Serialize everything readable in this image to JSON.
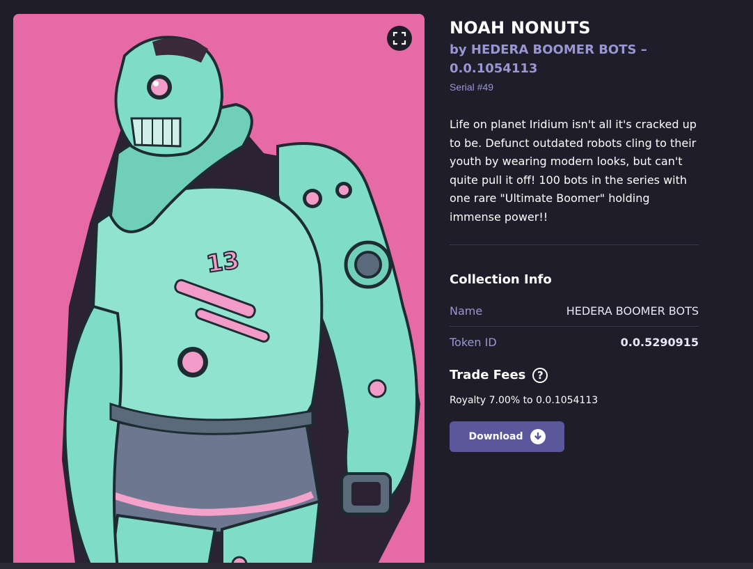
{
  "nft": {
    "title": "NOAH NONUTS",
    "by_line": "by HEDERA BOOMER BOTS – 0.0.1054113",
    "serial": "Serial #49",
    "description": "Life on planet Iridium isn't all it's cracked up to be. Defunct outdated robots cling to their youth by wearing modern looks, but can't quite pull it off! 100 bots in the series with one rare \"Ultimate Boomer\" holding immense power!!",
    "artwork_icon": "robot-artwork-image",
    "artwork_number": "13"
  },
  "collection_info": {
    "heading": "Collection Info",
    "rows": [
      {
        "label": "Name",
        "value": "HEDERA BOOMER BOTS"
      },
      {
        "label": "Token ID",
        "value": "0.0.5290915"
      }
    ]
  },
  "trade_fees": {
    "heading": "Trade Fees",
    "help_glyph": "?",
    "royalty": "Royalty 7.00% to 0.0.1054113"
  },
  "actions": {
    "download_label": "Download"
  },
  "colors": {
    "background": "#1e1d29",
    "artwork_bg": "#e56aa6",
    "robot": "#7fdcc6",
    "accent_text": "#9a96d2",
    "button": "#5a579c"
  },
  "icons": {
    "expand": "expand-icon",
    "help": "help-icon",
    "download": "download-icon"
  }
}
